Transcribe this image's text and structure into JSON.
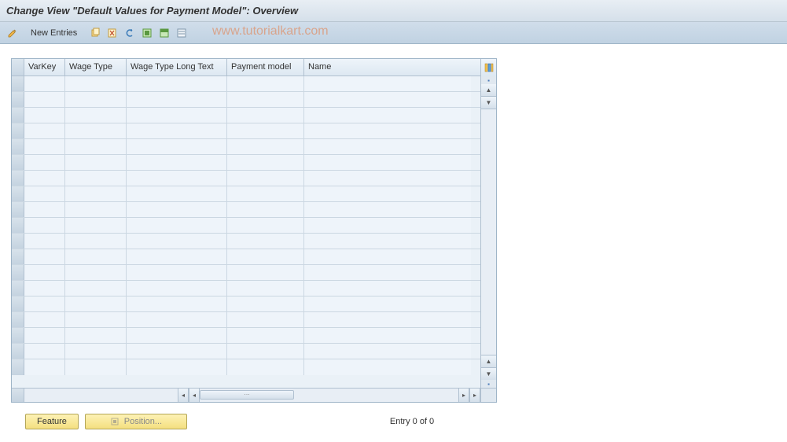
{
  "title": "Change View \"Default Values for Payment Model\": Overview",
  "toolbar": {
    "new_entries_label": "New Entries"
  },
  "watermark": "www.tutorialkart.com",
  "columns": {
    "varkey": "VarKey",
    "wagetype": "Wage Type",
    "wagelong": "Wage Type Long Text",
    "paymodel": "Payment model",
    "name": "Name"
  },
  "footer": {
    "feature_btn": "Feature",
    "position_btn": "Position...",
    "entry_text": "Entry 0 of 0"
  }
}
